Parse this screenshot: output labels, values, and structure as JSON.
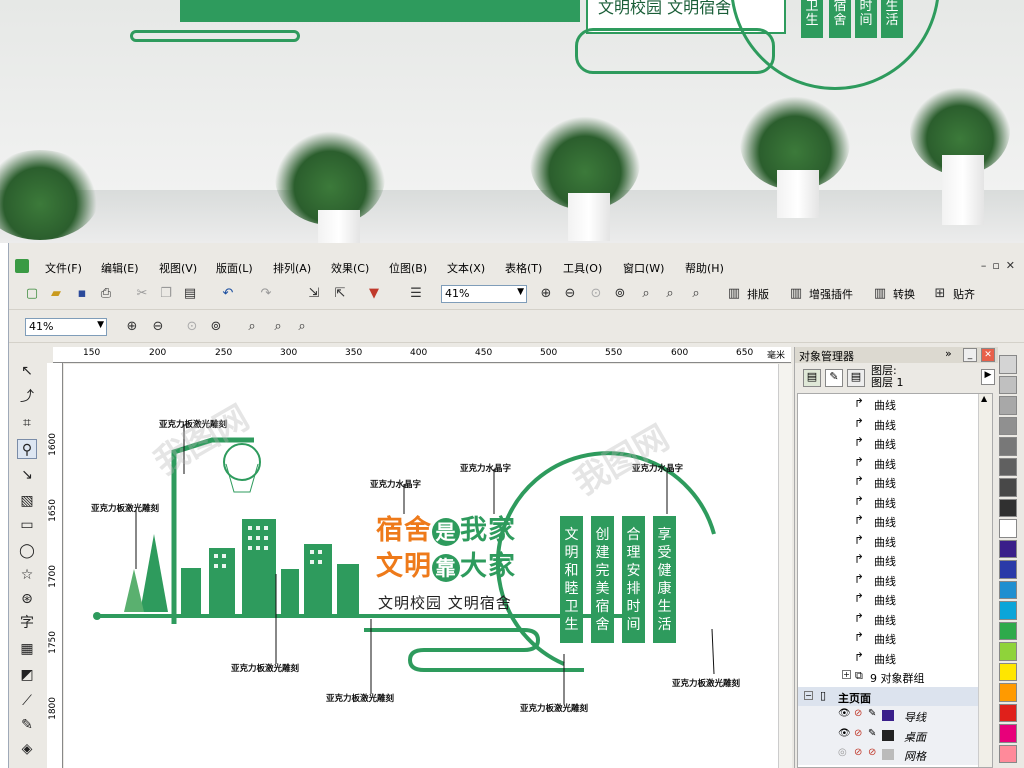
{
  "photo": {
    "sign_text": "文明校园 文明宿舍",
    "columns": [
      [
        "卫",
        "生"
      ],
      [
        "宿",
        "舍"
      ],
      [
        "时",
        "间"
      ],
      [
        "生",
        "活"
      ]
    ]
  },
  "menu": [
    "文件(F)",
    "编辑(E)",
    "视图(V)",
    "版面(L)",
    "排列(A)",
    "效果(C)",
    "位图(B)",
    "文本(X)",
    "表格(T)",
    "工具(O)",
    "窗口(W)",
    "帮助(H)"
  ],
  "toolbar": {
    "zoom_value": "41%",
    "typeset_label": "排版",
    "plugin_label": "增强插件",
    "convert_label": "转换",
    "paste_label": "贴齐"
  },
  "property_bar": {
    "zoom_value": "41%"
  },
  "ruler": {
    "h_ticks": [
      "150",
      "200",
      "250",
      "300",
      "350",
      "400",
      "450",
      "500",
      "550",
      "600",
      "650"
    ],
    "unit": "毫米",
    "v_ticks": [
      "1600",
      "1650",
      "1700",
      "1750",
      "1800"
    ]
  },
  "drawing": {
    "headline_1_orange": "宿舍",
    "headline_1_circle": "是",
    "headline_1_green": "我家",
    "headline_2_orange": "文明",
    "headline_2_circle": "靠",
    "headline_2_green": "大家",
    "subtitle": "文明校园 文明宿舍",
    "columns": [
      "文明和睦卫生",
      "创建完美宿舍",
      "合理安排时间",
      "享受健康生活"
    ],
    "labels": {
      "acrylic_laser_1": "亚克力板激光雕刻",
      "acrylic_laser_2": "亚克力板激光雕刻",
      "acrylic_laser_3": "亚克力板激光雕刻",
      "acrylic_laser_4": "亚克力板激光雕刻",
      "acrylic_laser_5": "亚克力板激光雕刻",
      "acrylic_laser_6": "亚克力板激光雕刻",
      "crystal_1": "亚克力水晶字",
      "crystal_2": "亚克力水晶字",
      "crystal_3": "亚克力水晶字"
    }
  },
  "object_manager": {
    "title": "对象管理器",
    "layer_label_1": "图层:",
    "layer_label_2": "图层 1",
    "curve_label": "曲线",
    "group_label": "9 对象群组",
    "master_page": "主页面",
    "master_layers": [
      {
        "name": "导线",
        "color": "#3a1f8a"
      },
      {
        "name": "桌面",
        "color": "#222222"
      },
      {
        "name": "网格",
        "color": "#bbbbbb"
      }
    ]
  },
  "palette": [
    "#d4d4d4",
    "#c0c0c0",
    "#a8a8a8",
    "#909090",
    "#787878",
    "#606060",
    "#484848",
    "#303030",
    "#ffffff",
    "#3a1f8a",
    "#2a3aa8",
    "#1f8fd0",
    "#0aa5d9",
    "#2eaa4b",
    "#8fd33a",
    "#ffe600",
    "#ff9a00",
    "#e0201b",
    "#e8007a",
    "#ff8a9a"
  ],
  "colors": {
    "accent_green": "#2e9b5d",
    "orange": "#ee7a1a"
  }
}
